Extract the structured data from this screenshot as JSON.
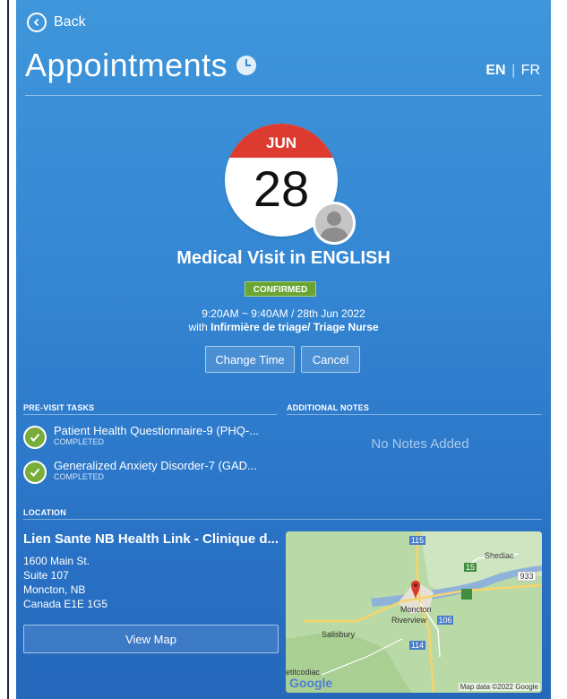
{
  "nav": {
    "back_label": "Back"
  },
  "header": {
    "title": "Appointments",
    "lang_en": "EN",
    "lang_sep": "|",
    "lang_fr": "FR"
  },
  "appointment": {
    "month": "JUN",
    "day": "28",
    "title": "Medical Visit in ENGLISH",
    "status": "CONFIRMED",
    "time_line": "9:20AM ~ 9:40AM / 28th Jun 2022",
    "with_prefix": "with",
    "with_name": "Infirmière de triage/ Triage Nurse",
    "change_time_label": "Change Time",
    "cancel_label": "Cancel"
  },
  "pre_visit": {
    "heading": "PRE-VISIT TASKS",
    "tasks": [
      {
        "title": "Patient Health Questionnaire-9 (PHQ-...",
        "status": "COMPLETED"
      },
      {
        "title": "Generalized Anxiety Disorder-7 (GAD...",
        "status": "COMPLETED"
      }
    ]
  },
  "notes": {
    "heading": "ADDITIONAL NOTES",
    "empty_text": "No Notes Added"
  },
  "location": {
    "heading": "LOCATION",
    "name": "Lien Sante NB Health Link - Clinique d...",
    "address_lines": [
      "1600 Main St.",
      "Suite 107",
      "Moncton, NB",
      "Canada E1E 1G5"
    ],
    "view_map_label": "View Map"
  },
  "map": {
    "labels": {
      "shediac": "Shediac",
      "moncton": "Moncton",
      "riverview": "Riverview",
      "salisbury": "Salisbury",
      "petitcodiac": "etitcodiac"
    },
    "routes": {
      "r115": "115",
      "r15": "15",
      "r933": "933",
      "r106": "106",
      "r114": "114"
    },
    "brand": "Google",
    "footer": "Map data ©2022 Google"
  },
  "colors": {
    "accent": "#3486d3",
    "calendar_red": "#dd3b30",
    "confirmed_green": "#6aa532",
    "check_green": "#79ad3b"
  },
  "icons": {
    "back": "chevron-left-circle-icon",
    "history": "clock-history-icon",
    "check": "check-circle-icon",
    "avatar": "user-avatar-icon",
    "pin": "map-pin-icon"
  }
}
